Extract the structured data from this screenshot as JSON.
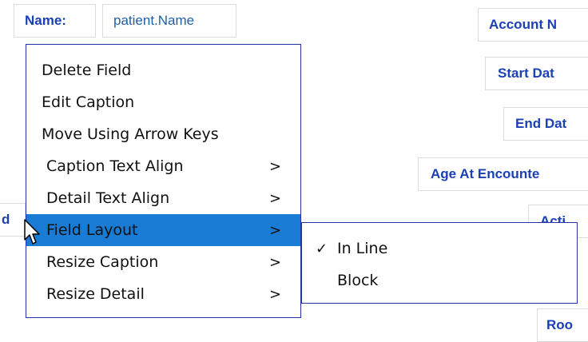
{
  "form": {
    "name_caption": "Name:",
    "name_value": "patient.Name",
    "account_caption": "Account N",
    "start_caption": "Start Dat",
    "end_caption": "End Dat",
    "age_caption": "Age At Encounte",
    "partial_left": "d",
    "partial_active": "Acti",
    "room_caption": "Roo"
  },
  "context_menu": {
    "items": [
      {
        "label": "Delete Field",
        "arrow": ""
      },
      {
        "label": "Edit Caption",
        "arrow": ""
      },
      {
        "label": "Move Using Arrow Keys",
        "arrow": ""
      },
      {
        "label": "Caption Text Align",
        "arrow": ">"
      },
      {
        "label": "Detail Text Align",
        "arrow": ">"
      },
      {
        "label": "Field Layout",
        "arrow": ">"
      },
      {
        "label": "Resize Caption",
        "arrow": ">"
      },
      {
        "label": "Resize Detail",
        "arrow": ">"
      }
    ],
    "highlight_color": "#1a7bd5"
  },
  "submenu": {
    "items": [
      {
        "check": "✓",
        "label": "In Line"
      },
      {
        "check": "",
        "label": "Block"
      }
    ]
  },
  "colors": {
    "caption_text": "#1b3fb5",
    "value_text": "#1e5fa8",
    "menu_border": "#2233aa"
  },
  "icons": {
    "cursor": "arrow-cursor-icon"
  }
}
